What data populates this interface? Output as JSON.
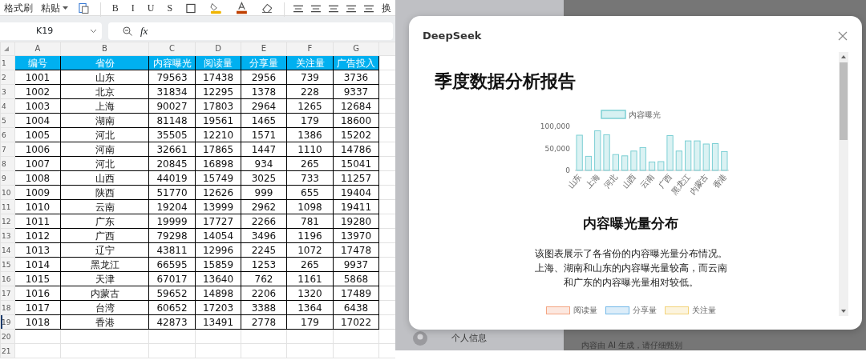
{
  "spreadsheet": {
    "toolbar": [
      {
        "kind": "text",
        "label": "格式刷"
      },
      {
        "kind": "dropdown",
        "label": "粘贴"
      },
      {
        "kind": "paste"
      },
      {
        "kind": "sep"
      },
      {
        "kind": "glyph",
        "label": "B"
      },
      {
        "kind": "glyph",
        "label": "I"
      },
      {
        "kind": "glyph",
        "label": "U"
      },
      {
        "kind": "glyph",
        "label": "S"
      },
      {
        "kind": "border"
      },
      {
        "kind": "fill",
        "color": "#f0b400"
      },
      {
        "kind": "fontcolor",
        "color": "#c04000"
      },
      {
        "kind": "clear"
      },
      {
        "kind": "sep"
      },
      {
        "kind": "align"
      },
      {
        "kind": "align"
      },
      {
        "kind": "align"
      },
      {
        "kind": "align"
      },
      {
        "kind": "align"
      },
      {
        "kind": "text",
        "label": "换"
      }
    ],
    "name_box": "K19",
    "fx_label": "fx",
    "columns": [
      "A",
      "B",
      "C",
      "D",
      "E",
      "F",
      "G"
    ],
    "row_numbers": [
      {
        "label": "1",
        "selected": false
      },
      {
        "label": "2",
        "selected": false
      },
      {
        "label": "3",
        "selected": false
      },
      {
        "label": "4",
        "selected": false
      },
      {
        "label": "5",
        "selected": false
      },
      {
        "label": "6",
        "selected": false
      },
      {
        "label": "7",
        "selected": false
      },
      {
        "label": "8",
        "selected": false
      },
      {
        "label": "9",
        "selected": false
      },
      {
        "label": "10",
        "selected": false
      },
      {
        "label": "11",
        "selected": false
      },
      {
        "label": "12",
        "selected": false
      },
      {
        "label": "13",
        "selected": false
      },
      {
        "label": "14",
        "selected": false
      },
      {
        "label": "15",
        "selected": false
      },
      {
        "label": "16",
        "selected": false
      },
      {
        "label": "17",
        "selected": false
      },
      {
        "label": "18",
        "selected": false
      },
      {
        "label": "19",
        "selected": true
      },
      {
        "label": "20",
        "selected": false
      },
      {
        "label": "21",
        "selected": false
      }
    ],
    "header": [
      "编号",
      "省份",
      "内容曝光",
      "阅读量",
      "分享量",
      "关注量",
      "广告投入"
    ],
    "rows": [
      [
        "1001",
        "山东",
        "79563",
        "17438",
        "2956",
        "739",
        "3736"
      ],
      [
        "1002",
        "北京",
        "31834",
        "12295",
        "1378",
        "228",
        "9337"
      ],
      [
        "1003",
        "上海",
        "90027",
        "17803",
        "2964",
        "1265",
        "12684"
      ],
      [
        "1004",
        "湖南",
        "81148",
        "19561",
        "1465",
        "179",
        "18600"
      ],
      [
        "1005",
        "河北",
        "35505",
        "12210",
        "1571",
        "1386",
        "15202"
      ],
      [
        "1006",
        "河南",
        "32661",
        "17865",
        "1447",
        "1110",
        "14786"
      ],
      [
        "1007",
        "河北",
        "20845",
        "16898",
        "934",
        "265",
        "15041"
      ],
      [
        "1008",
        "山西",
        "44019",
        "15749",
        "3025",
        "733",
        "11257"
      ],
      [
        "1009",
        "陕西",
        "51770",
        "12626",
        "999",
        "655",
        "19404"
      ],
      [
        "1010",
        "云南",
        "19204",
        "13999",
        "2962",
        "1098",
        "19411"
      ],
      [
        "1011",
        "广东",
        "19999",
        "17727",
        "2266",
        "781",
        "19280"
      ],
      [
        "1012",
        "广西",
        "79298",
        "14054",
        "3496",
        "1196",
        "13970"
      ],
      [
        "1013",
        "辽宁",
        "43811",
        "12996",
        "2245",
        "1072",
        "17478"
      ],
      [
        "1014",
        "黑龙江",
        "66595",
        "15859",
        "1253",
        "265",
        "9937"
      ],
      [
        "1015",
        "天津",
        "67017",
        "13640",
        "762",
        "1161",
        "5868"
      ],
      [
        "1016",
        "内蒙古",
        "59652",
        "14898",
        "2206",
        "1320",
        "17489"
      ],
      [
        "1017",
        "台湾",
        "60652",
        "17203",
        "3388",
        "1364",
        "6438"
      ],
      [
        "1018",
        "香港",
        "42873",
        "13491",
        "2778",
        "179",
        "17022"
      ]
    ]
  },
  "background_app": {
    "profile_label": "个人信息",
    "footer_note": "内容由 AI 生成，请仔细甄别"
  },
  "dialog": {
    "title": "DeepSeek",
    "report_title": "季度数据分析报告",
    "chart_data": {
      "type": "bar",
      "yticks": [
        {
          "value": 0,
          "label": "0"
        },
        {
          "value": 50000,
          "label": "50,000"
        },
        {
          "value": 100000,
          "label": "100,000"
        }
      ],
      "ylim": [
        0,
        100000
      ],
      "categories": [
        "山东",
        null,
        "上海",
        null,
        "河北",
        null,
        "山西",
        null,
        "云南",
        null,
        "广西",
        null,
        "黑龙江",
        null,
        "内蒙古",
        null,
        "香港"
      ],
      "series": [
        {
          "name": "内容曝光",
          "color": "#7ccfd4",
          "values": [
            80000,
            32000,
            90000,
            81000,
            36000,
            33000,
            44000,
            52000,
            19000,
            20000,
            79000,
            44000,
            67000,
            67000,
            60000,
            61000,
            43000
          ]
        }
      ]
    },
    "chart_title": "内容曝光量分布",
    "description": "该图表展示了各省份的内容曝光量分布情况。上海、湖南和山东的内容曝光量较高，而云南和广东的内容曝光量相对较低。",
    "next_chart_legend": [
      {
        "name": "阅读量",
        "color": "#f4a582"
      },
      {
        "name": "分享量",
        "color": "#74b9e8"
      },
      {
        "name": "关注量",
        "color": "#f3d37a"
      }
    ]
  }
}
